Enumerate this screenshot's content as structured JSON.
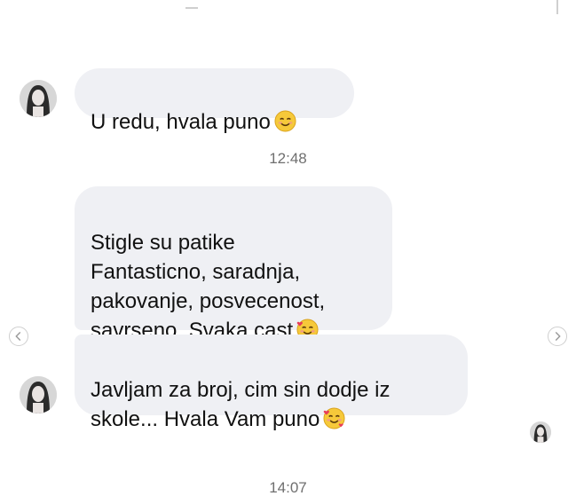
{
  "messages": [
    {
      "text": "U redu, hvala puno",
      "emoji": "smiling-face-emoji"
    },
    {
      "text": "Stigle su patike\nFantasticno, saradnja,\npakovanje, posvecenost,\nsavrseno. Svaka cast",
      "emoji": "smiling-face-with-hearts-emoji"
    },
    {
      "text": "Javljam za broj, cim sin dodje iz\nskole... Hvala Vam puno",
      "emoji": "smiling-face-with-hearts-emoji"
    }
  ],
  "timestamps": [
    "12:48",
    "14:07"
  ],
  "icons": {
    "prev": "chevron-left-icon",
    "next": "chevron-right-icon"
  },
  "colors": {
    "bubble": "#eff0f4",
    "timestamp": "#6f6f6f"
  }
}
